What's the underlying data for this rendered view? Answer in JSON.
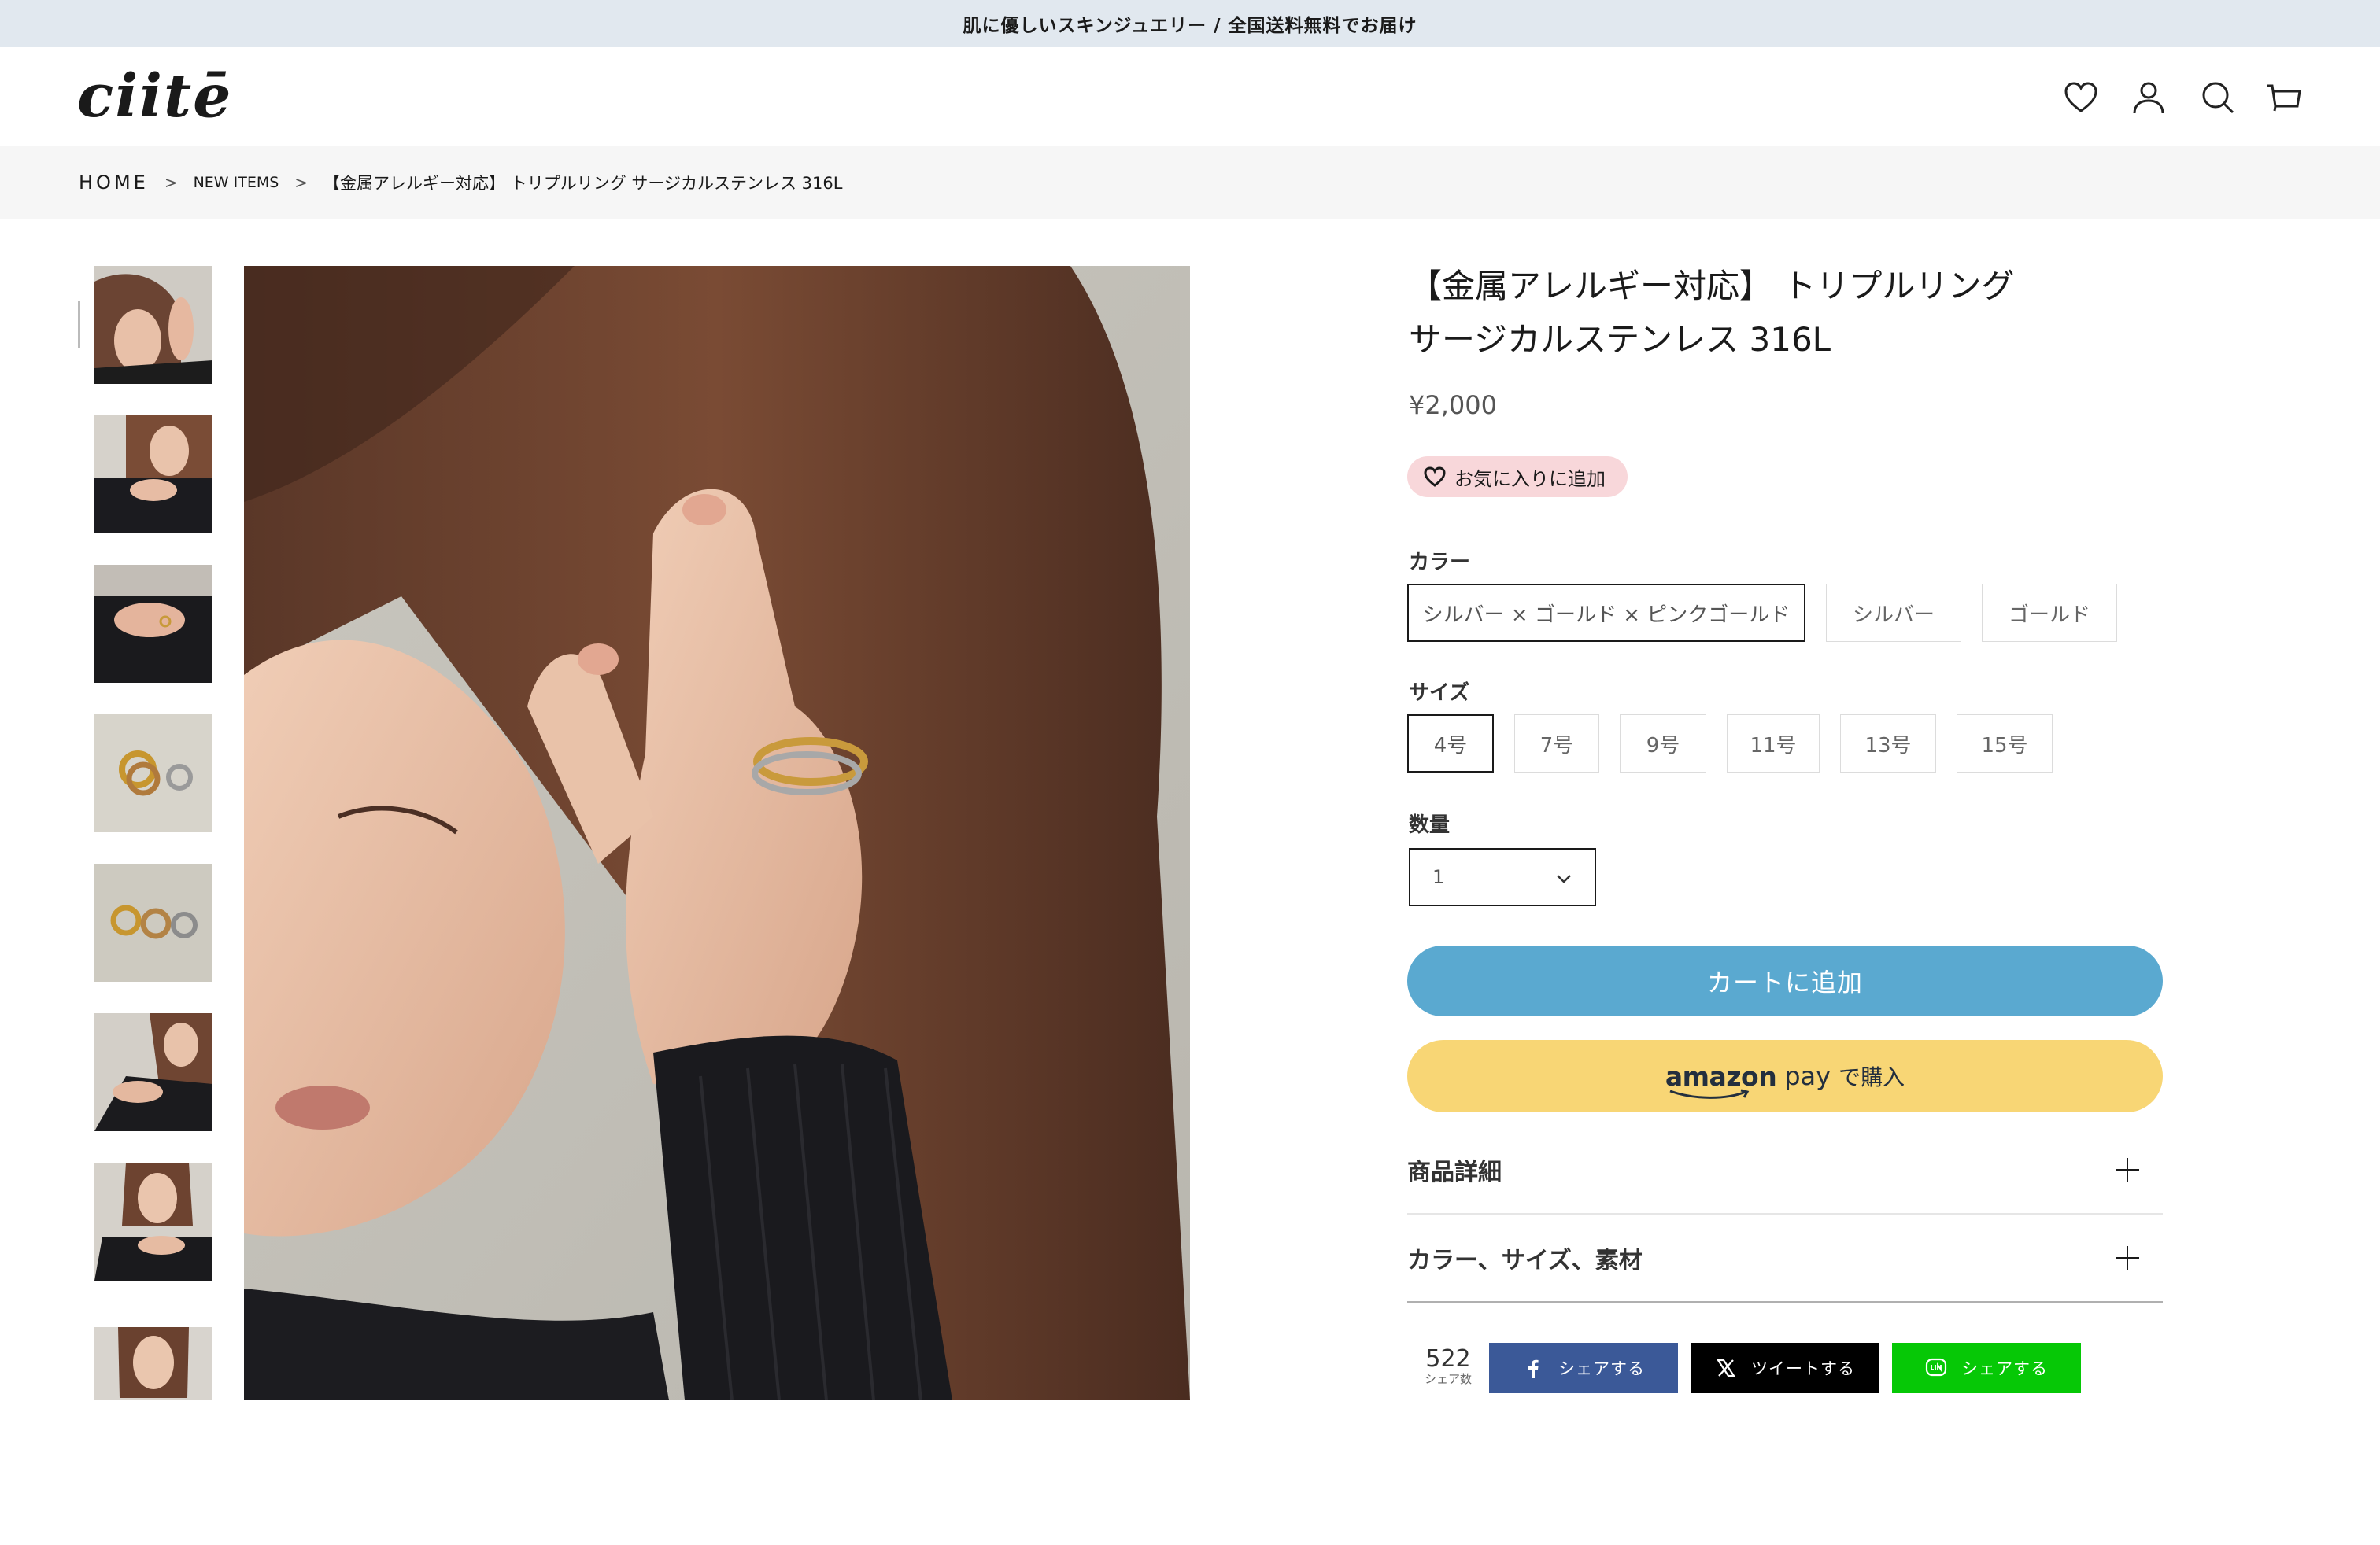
{
  "announcement": "肌に優しいスキンジュエリー / 全国送料無料でお届け",
  "header": {
    "logo": "ciitē",
    "icons": [
      "heart-icon",
      "account-icon",
      "search-icon",
      "cart-icon"
    ]
  },
  "breadcrumb": {
    "home": "HOME",
    "sep": ">",
    "category": "NEW ITEMS",
    "current": "【金属アレルギー対応】 トリプルリング サージカルステンレス 316L"
  },
  "product": {
    "title_line1": "【金属アレルギー対応】 トリプルリング",
    "title_line2": "サージカルステンレス 316L",
    "price": "¥2,000",
    "favorite_label": "お気に入りに追加"
  },
  "color": {
    "label": "カラー",
    "options": [
      "シルバー × ゴールド × ピンクゴールド",
      "シルバー",
      "ゴールド"
    ],
    "selected": "シルバー × ゴールド × ピンクゴールド"
  },
  "size": {
    "label": "サイズ",
    "options": [
      "4号",
      "7号",
      "9号",
      "11号",
      "13号",
      "15号"
    ],
    "selected": "4号"
  },
  "quantity": {
    "label": "数量",
    "value": "1"
  },
  "buttons": {
    "add_to_cart": "カートに追加",
    "amazon_logo": "amazon",
    "amazon_pay": "pay",
    "amazon_buy": "で購入"
  },
  "accordions": [
    "商品詳細",
    "カラー、サイズ、素材"
  ],
  "share": {
    "count": "522",
    "count_label": "シェア数",
    "facebook": "シェアする",
    "x": "ツイートする",
    "line": "シェアする"
  },
  "colors": {
    "announcement_bg": "#e1e8ef",
    "cart_button": "#5aa9d0",
    "amazon_button": "#f8d675",
    "favorite_bg": "#f8d7da",
    "facebook": "#3b5998",
    "x": "#000000",
    "line": "#06c806"
  }
}
